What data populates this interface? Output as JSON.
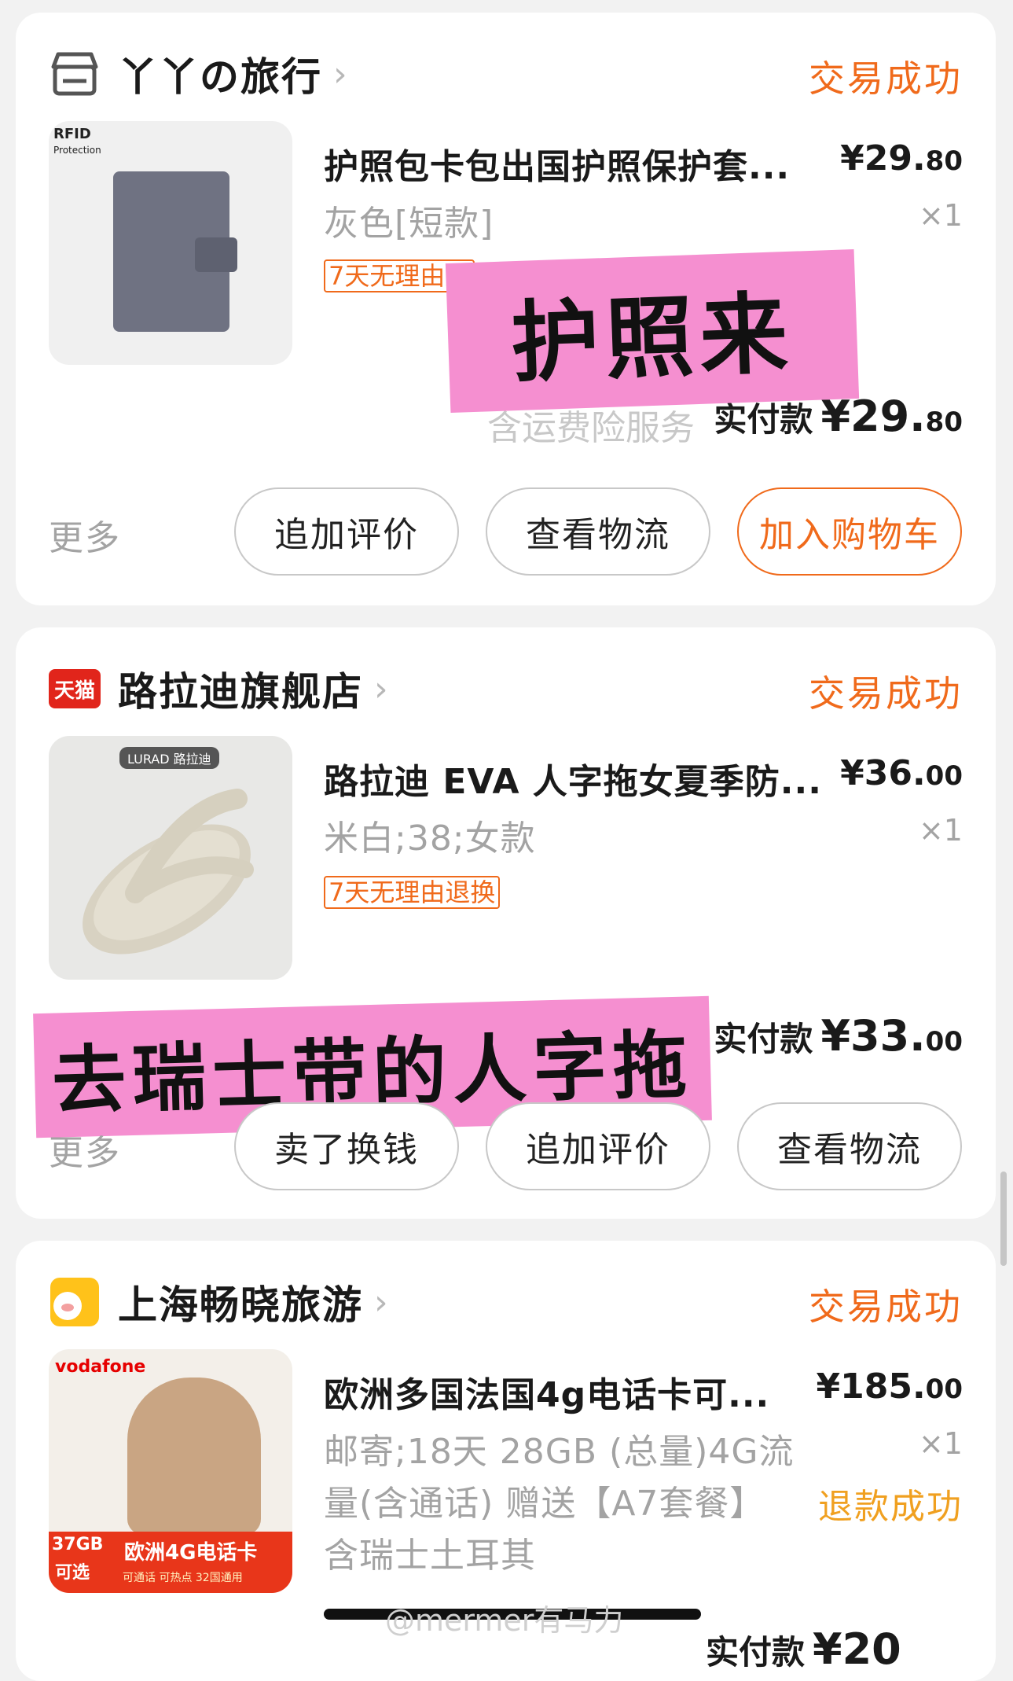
{
  "orders": [
    {
      "shop_name": "丫丫の旅行",
      "status": "交易成功",
      "product_title": "护照包卡包出国护照保护套...",
      "price_int": "¥29.",
      "price_dec": "80",
      "variant": "灰色[短款]",
      "qty": "×1",
      "tag": "7天无理由退",
      "thumb_text_1": "RFID",
      "thumb_text_2": "Protection",
      "shipping_note": "含运费险服务",
      "paid_label": "实付款",
      "paid_int": "¥29.",
      "paid_dec": "80",
      "more": "更多",
      "buttons": [
        "追加评价",
        "查看物流",
        "加入购物车"
      ],
      "sticker": "护照来"
    },
    {
      "shop_name": "路拉迪旗舰店",
      "shop_badge": "天猫",
      "status": "交易成功",
      "product_title": "路拉迪 EVA 人字拖女夏季防...",
      "price_int": "¥36.",
      "price_dec": "00",
      "variant": "米白;38;女款",
      "qty": "×1",
      "tag": "7天无理由退换",
      "thumb_brand": "LURAD 路拉迪",
      "paid_label": "实付款",
      "paid_int": "¥33.",
      "paid_dec": "00",
      "more": "更多",
      "buttons": [
        "卖了换钱",
        "追加评价",
        "查看物流"
      ],
      "sticker": "去瑞士带的人字拖"
    },
    {
      "shop_name": "上海畅晓旅游",
      "status": "交易成功",
      "product_title": "欧洲多国法国4g电话卡可...",
      "price_int": "¥185.",
      "price_dec": "00",
      "variant_lines": [
        "邮寄;18天 28GB (总量)4G流",
        "量(含通话) 赠送【A7套餐】",
        "含瑞士土耳其"
      ],
      "qty": "×1",
      "refund_status": "退款成功",
      "thumb_brand": "vodafone",
      "thumb_badge_1": "37GB",
      "thumb_badge_2": "可选",
      "thumb_banner": "欧洲4G电话卡",
      "thumb_sub": "可通话  可热点  32国通用",
      "paid_label": "实付款",
      "paid_int": "¥20"
    }
  ],
  "watermark": "@mermer有马力",
  "colors": {
    "accent": "#f06a1b",
    "sticker": "#f58fd0",
    "refund": "#f0a020",
    "tmall": "#e1251b"
  }
}
